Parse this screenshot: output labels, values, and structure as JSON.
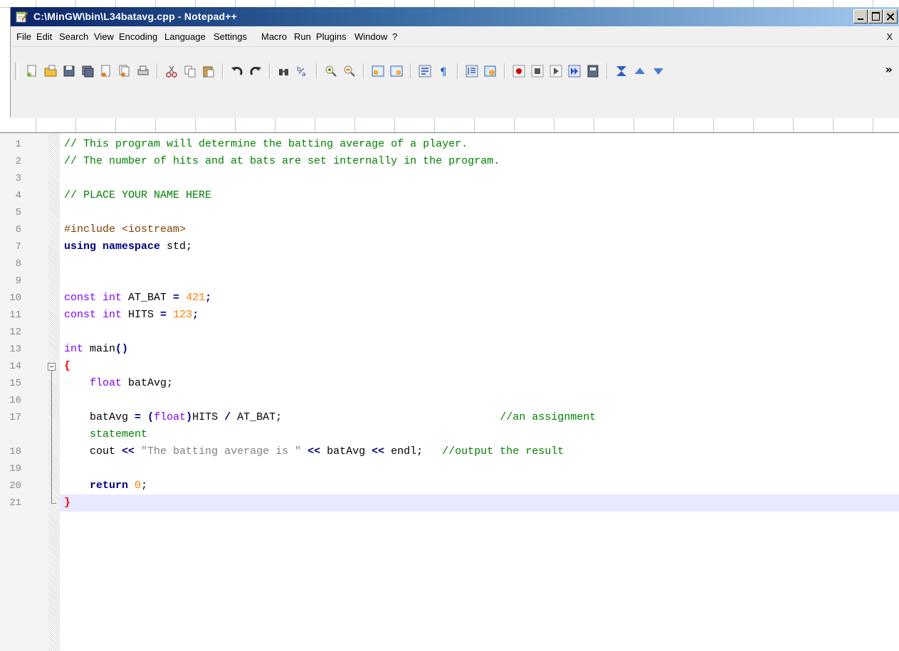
{
  "window": {
    "title": "C:\\MinGW\\bin\\L34batavg.cpp - Notepad++",
    "buttons": [
      "minimize",
      "maximize",
      "close"
    ]
  },
  "menu": {
    "items": [
      "File",
      "Edit",
      "Search",
      "View",
      "Encoding",
      "Language",
      "Settings",
      "Macro",
      "Run",
      "Plugins",
      "Window",
      "?"
    ],
    "close_label": "X"
  },
  "toolbar": {
    "groups": [
      [
        "new-file-icon",
        "open-file-icon",
        "save-icon",
        "save-all-icon",
        "close-icon",
        "close-all-icon",
        "print-icon"
      ],
      [
        "cut-icon",
        "copy-icon",
        "paste-icon"
      ],
      [
        "undo-icon",
        "redo-icon"
      ],
      [
        "find-icon",
        "replace-icon"
      ],
      [
        "zoom-in-icon",
        "zoom-out-icon"
      ],
      [
        "sync-vertical-icon",
        "sync-horizontal-icon"
      ],
      [
        "word-wrap-icon",
        "show-all-chars-icon"
      ],
      [
        "indent-guide-icon",
        "user-lang-icon"
      ],
      [
        "record-macro-icon",
        "stop-macro-icon",
        "play-macro-icon",
        "run-macro-multiple-icon",
        "save-macro-icon"
      ],
      [
        "trim-icon",
        "up-arrow-icon",
        "down-arrow-icon"
      ]
    ],
    "more_label": "»",
    "colors": {
      "record": "#cc0000",
      "accent": "#3a6ea5"
    }
  },
  "editor": {
    "lines": [
      {
        "n": "1",
        "tokens": [
          {
            "t": "// This program will determine the batting average of a player.",
            "c": "comment"
          }
        ]
      },
      {
        "n": "2",
        "tokens": [
          {
            "t": "// The number of hits and at bats are set internally in the program.",
            "c": "comment"
          }
        ]
      },
      {
        "n": "3",
        "tokens": []
      },
      {
        "n": "4",
        "tokens": [
          {
            "t": "// PLACE YOUR NAME HERE",
            "c": "comment"
          }
        ]
      },
      {
        "n": "5",
        "tokens": []
      },
      {
        "n": "6",
        "tokens": [
          {
            "t": "#include <iostream>",
            "c": "pre"
          }
        ]
      },
      {
        "n": "7",
        "tokens": [
          {
            "t": "using namespace",
            "c": "kw"
          },
          {
            "t": " std;",
            "c": "plain"
          }
        ]
      },
      {
        "n": "8",
        "tokens": []
      },
      {
        "n": "9",
        "tokens": []
      },
      {
        "n": "10",
        "tokens": [
          {
            "t": "const int",
            "c": "type"
          },
          {
            "t": " AT_BAT ",
            "c": "plain"
          },
          {
            "t": "=",
            "c": "op"
          },
          {
            "t": " ",
            "c": "plain"
          },
          {
            "t": "421",
            "c": "num"
          },
          {
            "t": ";",
            "c": "op"
          }
        ]
      },
      {
        "n": "11",
        "tokens": [
          {
            "t": "const int",
            "c": "type"
          },
          {
            "t": " HITS ",
            "c": "plain"
          },
          {
            "t": "=",
            "c": "op"
          },
          {
            "t": " ",
            "c": "plain"
          },
          {
            "t": "123",
            "c": "num"
          },
          {
            "t": ";",
            "c": "op"
          }
        ]
      },
      {
        "n": "12",
        "tokens": []
      },
      {
        "n": "13",
        "tokens": [
          {
            "t": "int",
            "c": "type"
          },
          {
            "t": " main",
            "c": "plain"
          },
          {
            "t": "()",
            "c": "op"
          }
        ]
      },
      {
        "n": "14",
        "tokens": [
          {
            "t": "{",
            "c": "brace"
          }
        ]
      },
      {
        "n": "15",
        "tokens": [
          {
            "t": "    ",
            "c": "plain"
          },
          {
            "t": "float",
            "c": "type"
          },
          {
            "t": " batAvg;",
            "c": "plain"
          }
        ]
      },
      {
        "n": "16",
        "tokens": []
      },
      {
        "n": "17",
        "tokens": [
          {
            "t": "    batAvg ",
            "c": "plain"
          },
          {
            "t": "=",
            "c": "op"
          },
          {
            "t": " ",
            "c": "plain"
          },
          {
            "t": "(",
            "c": "op"
          },
          {
            "t": "float",
            "c": "type"
          },
          {
            "t": ")",
            "c": "op"
          },
          {
            "t": "HITS ",
            "c": "plain"
          },
          {
            "t": "/",
            "c": "op"
          },
          {
            "t": " AT_BAT;",
            "c": "plain"
          },
          {
            "t": "                                  //an assignment",
            "c": "comment"
          }
        ]
      },
      {
        "n": "",
        "tokens": [
          {
            "t": "    statement",
            "c": "comment"
          }
        ]
      },
      {
        "n": "18",
        "tokens": [
          {
            "t": "    cout ",
            "c": "plain"
          },
          {
            "t": "<<",
            "c": "op"
          },
          {
            "t": " ",
            "c": "plain"
          },
          {
            "t": "\"The batting average is \"",
            "c": "str"
          },
          {
            "t": " ",
            "c": "plain"
          },
          {
            "t": "<<",
            "c": "op"
          },
          {
            "t": " batAvg ",
            "c": "plain"
          },
          {
            "t": "<<",
            "c": "op"
          },
          {
            "t": " endl;   ",
            "c": "plain"
          },
          {
            "t": "//output the result",
            "c": "comment"
          }
        ]
      },
      {
        "n": "19",
        "tokens": []
      },
      {
        "n": "20",
        "tokens": [
          {
            "t": "    ",
            "c": "plain"
          },
          {
            "t": "return",
            "c": "kw"
          },
          {
            "t": " ",
            "c": "plain"
          },
          {
            "t": "0",
            "c": "num"
          },
          {
            "t": ";",
            "c": "plain"
          }
        ]
      },
      {
        "n": "21",
        "tokens": [
          {
            "t": "}",
            "c": "brace"
          }
        ],
        "current": true
      }
    ]
  }
}
